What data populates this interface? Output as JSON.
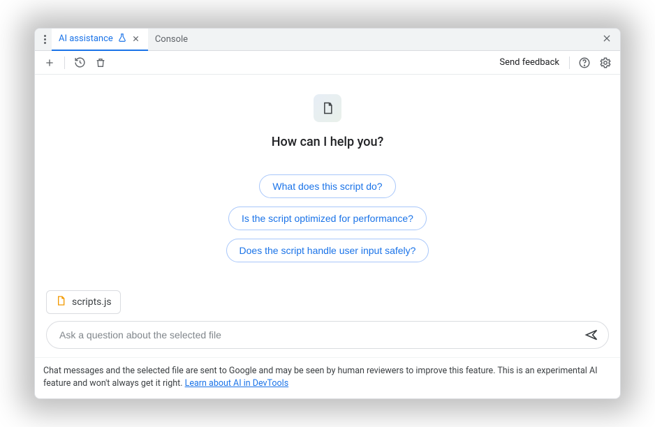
{
  "tabs": {
    "active": {
      "label": "AI assistance"
    },
    "second": {
      "label": "Console"
    }
  },
  "toolbar": {
    "feedback": "Send feedback"
  },
  "hero": {
    "title": "How can I help you?"
  },
  "suggestions": [
    "What does this script do?",
    "Is the script optimized for performance?",
    "Does the script handle user input safely?"
  ],
  "context": {
    "filename": "scripts.js"
  },
  "input": {
    "placeholder": "Ask a question about the selected file"
  },
  "footer": {
    "text_before": "Chat messages and the selected file are sent to Google and may be seen by human reviewers to improve this feature. This is an experimental AI feature and won't always get it right. ",
    "link_text": "Learn about AI in DevTools"
  }
}
